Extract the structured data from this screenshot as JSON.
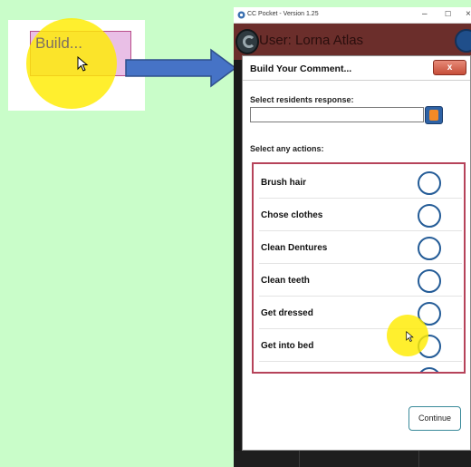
{
  "inset": {
    "build_button_label": "Build..."
  },
  "window": {
    "title": "CC Pocket - Version 1.25",
    "minimize": "–",
    "maximize": "☐",
    "close": "×",
    "user_label": "User: Lorna Atlas"
  },
  "dialog": {
    "title": "Build Your Comment...",
    "close_label": "x",
    "response_label": "Select residents response:",
    "response_value": "",
    "actions_label": "Select any actions:",
    "actions": [
      {
        "label": "Brush hair"
      },
      {
        "label": "Chose clothes"
      },
      {
        "label": "Clean Dentures"
      },
      {
        "label": "Clean teeth"
      },
      {
        "label": "Get dressed"
      },
      {
        "label": "Get into bed"
      }
    ],
    "continue_label": "Continue"
  },
  "colors": {
    "background": "#c9fdc9",
    "header": "#6b2e2b",
    "list_border": "#b6435a",
    "radio": "#245c97",
    "highlight": "#ffeb00"
  },
  "icons": [
    "app-icon",
    "logo-icon",
    "menu-icon",
    "dropdown-arrow-icon",
    "cursor-icon",
    "arrow-icon"
  ]
}
